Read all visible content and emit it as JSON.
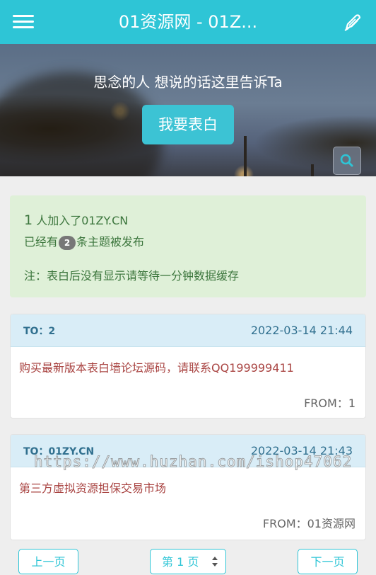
{
  "header": {
    "title": "01资源网 - 01Z..."
  },
  "hero": {
    "tagline": "思念的人 想说的话这里告诉Ta",
    "confess_label": "我要表白"
  },
  "stats": {
    "joined_count": "1",
    "joined_text": "人加入了01ZY.CN",
    "posted_prefix": "已经有",
    "posted_count": "2",
    "posted_suffix": "条主题被发布",
    "note": "注：表白后没有显示请等待一分钟数据缓存"
  },
  "posts": [
    {
      "to": "TO：2",
      "time": "2022-03-14 21:44",
      "message": "购买最新版本表白墙论坛源码，请联系QQ199999411",
      "from": "FROM：1"
    },
    {
      "to": "TO：01ZY.CN",
      "time": "2022-03-14 21:43",
      "message": "第三方虚拟资源担保交易市场",
      "from": "FROM：01资源网"
    }
  ],
  "pager": {
    "prev_label": "上一页",
    "page_label": "第 1 页",
    "next_label": "下一页"
  },
  "watermark": "https://www.huzhan.com/ishop47062",
  "colors": {
    "accent": "#2ec5d6",
    "success_bg": "#dff0d8",
    "info_bg": "#d9edf7"
  }
}
